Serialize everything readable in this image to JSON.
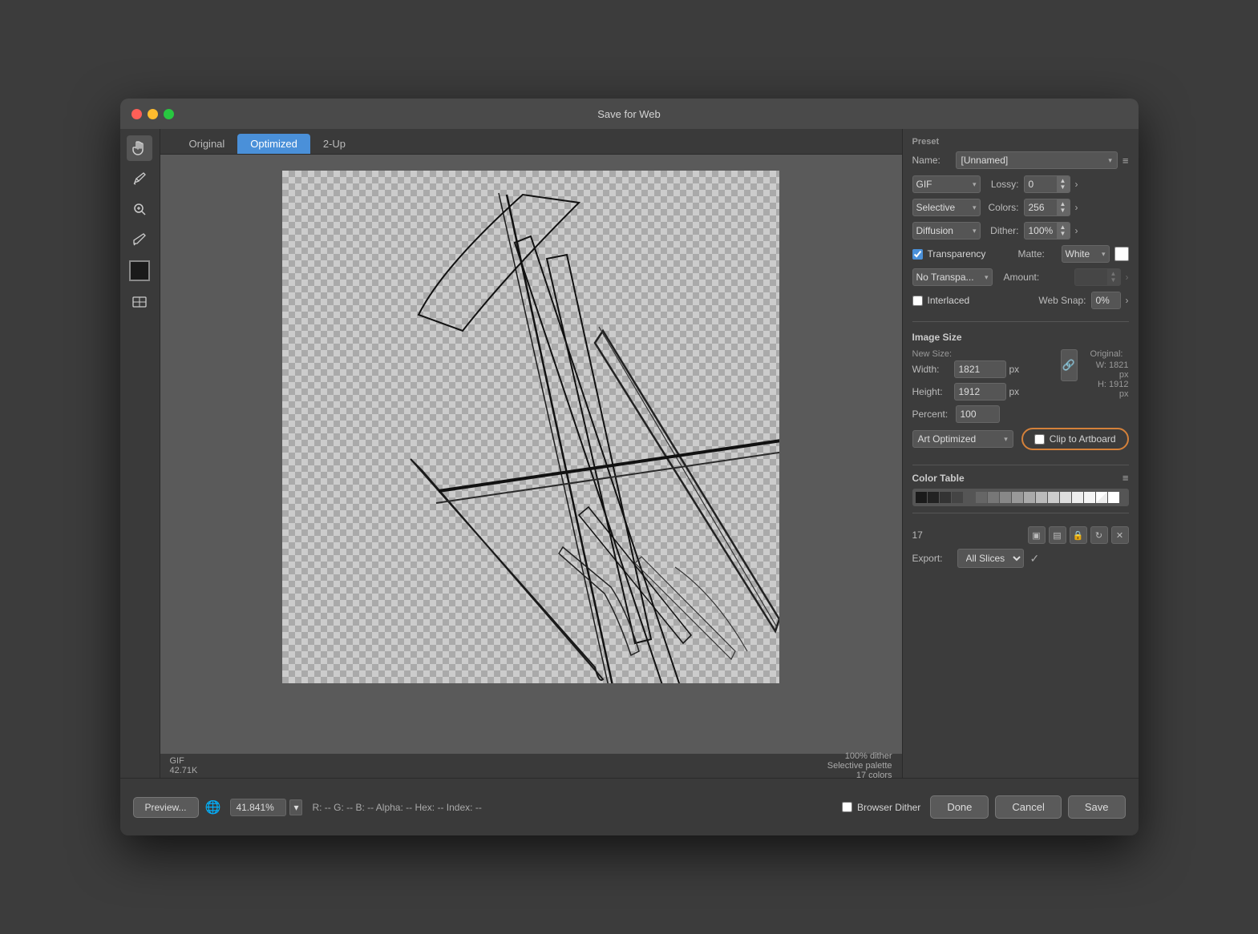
{
  "window": {
    "title": "Save for Web"
  },
  "tabs": [
    {
      "id": "original",
      "label": "Original",
      "active": false
    },
    {
      "id": "optimized",
      "label": "Optimized",
      "active": true
    },
    {
      "id": "two-up",
      "label": "2-Up",
      "active": false
    }
  ],
  "tools": [
    {
      "id": "hand",
      "icon": "✋",
      "active": true
    },
    {
      "id": "eyedropper",
      "icon": "✒",
      "active": false
    },
    {
      "id": "zoom",
      "icon": "🔍",
      "active": false
    },
    {
      "id": "sample",
      "icon": "💧",
      "active": false
    }
  ],
  "status": {
    "left": "GIF\n42.71K",
    "right": "100% dither\nSelective palette\n17 colors"
  },
  "bottom": {
    "zoom_value": "41.841%",
    "pixel_info": "R: --  G: --  B: --  Alpha: --  Hex: --  Index: --",
    "preview_label": "Preview...",
    "browser_dither_label": "Browser Dither",
    "done_label": "Done",
    "cancel_label": "Cancel",
    "save_label": "Save"
  },
  "preset": {
    "section_label": "Preset",
    "name_label": "Name:",
    "name_value": "[Unnamed]",
    "format_value": "GIF",
    "lossy_label": "Lossy:",
    "lossy_value": "0",
    "palette_value": "Selective",
    "colors_label": "Colors:",
    "colors_value": "256",
    "dither_method": "Diffusion",
    "dither_label": "Dither:",
    "dither_value": "100%",
    "transparency_label": "Transparency",
    "transparency_checked": true,
    "matte_label": "Matte:",
    "matte_value": "White",
    "no_transparency_value": "No Transpa...",
    "amount_label": "Amount:",
    "interlaced_label": "Interlaced",
    "interlaced_checked": false,
    "web_snap_label": "Web Snap:",
    "web_snap_value": "0%"
  },
  "image_size": {
    "section_label": "Image Size",
    "new_size_label": "New Size:",
    "width_label": "Width:",
    "width_value": "1821",
    "height_label": "Height:",
    "height_value": "1912",
    "px_label": "px",
    "percent_label": "Percent:",
    "percent_value": "100",
    "original_label": "Original:",
    "original_w": "W: 1821 px",
    "original_h": "H: 1912 px",
    "algorithm_value": "Art Optimized",
    "clip_artboard_label": "Clip to Artboard",
    "clip_artboard_checked": false
  },
  "color_table": {
    "section_label": "Color Table",
    "count": "17",
    "swatches": [
      "#1a1a1a",
      "#333333",
      "#4d4d4d",
      "#666666",
      "#808080",
      "#999999",
      "#b3b3b3",
      "#cccccc",
      "#e6e6e6",
      "#f0f0f0",
      "#ffffff",
      "#111111",
      "#222222",
      "#2a2a2a",
      "#3a3a3a",
      "#444444",
      "#555555"
    ]
  },
  "export": {
    "label": "Export:",
    "value": "All Slices",
    "checkmark": "✓"
  }
}
